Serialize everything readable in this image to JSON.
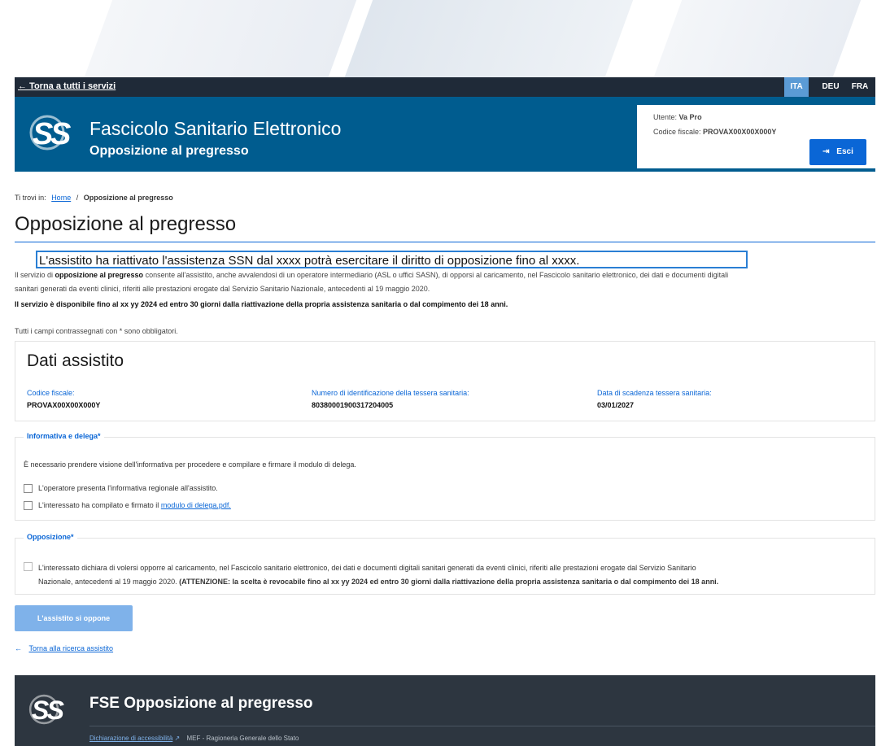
{
  "topbar": {
    "back_label": "← Torna a tutti i servizi",
    "languages": [
      "ITA",
      "DEU",
      "FRA"
    ]
  },
  "header": {
    "app_title": "Fascicolo Sanitario Elettronico",
    "app_subtitle": "Opposizione al pregresso",
    "user_label": "Utente:",
    "user_name": "Va Pro",
    "cf_label": "Codice fiscale:",
    "cf_value": "PROVAX00X00X000Y",
    "exit_label": "Esci"
  },
  "breadcrumb": {
    "prefix": "Ti trovi in:",
    "home": "Home",
    "separator": "/",
    "current": "Opposizione al pregresso"
  },
  "page": {
    "title": "Opposizione al pregresso",
    "alert_text": "L'assistito ha riattivato l'assistenza SSN dal xxxx potrà esercitare il diritto di opposizione fino al xxxx.",
    "intro_line1_prefix": "Il servizio di",
    "intro_line1_bold": "opposizione al pregresso",
    "intro_line1_rest": "consente all'assistito, anche avvalendosi di un operatore intermediario (ASL o uffici SASN), di opporsi al caricamento, nel Fascicolo sanitario elettronico, dei dati e documenti digitali",
    "intro_line2": "sanitari generati da eventi clinici, riferiti alle prestazioni erogate dal Servizio Sanitario Nazionale, antecedenti al 19 maggio 2020.",
    "intro_line3": "Il servizio è disponibile fino al xx yy 2024 ed entro 30 giorni dalla riattivazione della propria assistenza sanitaria o dal compimento dei 18 anni.",
    "required_note": "Tutti i campi contrassegnati con * sono obbligatori."
  },
  "dati": {
    "title": "Dati assistito",
    "cf_label": "Codice fiscale:",
    "cf_value": "PROVAX00X00X000Y",
    "tessera_label": "Numero di identificazione della tessera sanitaria:",
    "tessera_value": "80380001900317204005",
    "scadenza_label": "Data di scadenza tessera sanitaria:",
    "scadenza_value": "03/01/2027"
  },
  "informativa": {
    "legend": "Informativa e delega*",
    "text": "È necessario prendere visione dell'informativa per procedere e compilare e firmare il modulo di delega.",
    "check1": "L'operatore presenta l'informativa regionale all'assistito.",
    "check2_prefix": "L'interessato ha compilato e firmato il",
    "check2_link": "modulo di delega.pdf."
  },
  "opposizione": {
    "legend": "Opposizione*",
    "line1": "L'interessato dichiara di volersi opporre al caricamento, nel Fascicolo sanitario elettronico, dei dati e documenti digitali sanitari generati da eventi clinici, riferiti alle prestazioni erogate dal Servizio Sanitario",
    "line2_prefix": "Nazionale, antecedenti al 19 maggio 2020.",
    "line2_bold": "(ATTENZIONE: la scelta è revocabile fino al xx yy 2024 ed entro 30 giorni dalla riattivazione della propria assistenza sanitaria o dal compimento dei 18 anni."
  },
  "actions": {
    "oppose_label": "L'assistito si oppone",
    "back_search": "Torna alla ricerca assistito"
  },
  "footer": {
    "title": "FSE Opposizione al pregresso",
    "accessibility": "Dichiarazione di accessibilità",
    "org": "MEF - Ragioneria Generale dello Stato"
  },
  "colors": {
    "header_bg": "#005c8f",
    "topbar_bg": "#1f2a38",
    "footer_bg": "#2d3640",
    "accent": "#0a66d6",
    "disabled_button": "#7fb2ea"
  }
}
